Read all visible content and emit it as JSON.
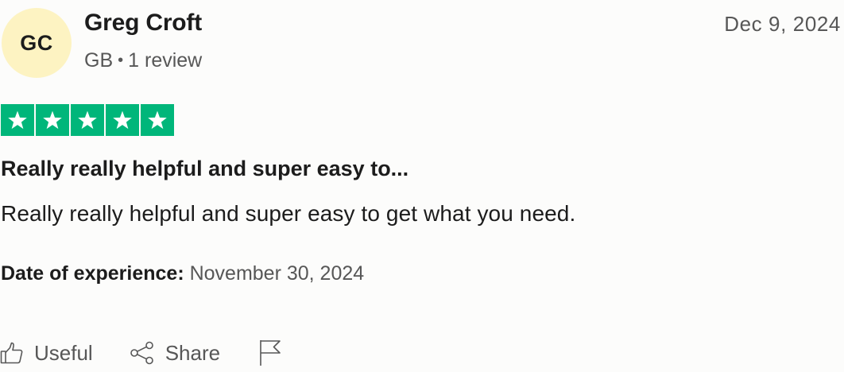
{
  "reviewer": {
    "initials": "GC",
    "name": "Greg Croft",
    "country": "GB",
    "separator": "•",
    "review_count": "1 review",
    "avatar_color": "#fdf3c2"
  },
  "review": {
    "date": "Dec 9, 2024",
    "rating": 5,
    "max_rating": 5,
    "star_color": "#00b67a",
    "title": "Really really helpful and super easy to...",
    "body": "Really really helpful and super easy to get what you need.",
    "experience_label": "Date of experience:",
    "experience_date": "November 30, 2024"
  },
  "actions": {
    "useful_label": "Useful",
    "useful_icon": "thumbs-up-icon",
    "share_label": "Share",
    "share_icon": "share-icon",
    "report_icon": "flag-icon"
  }
}
